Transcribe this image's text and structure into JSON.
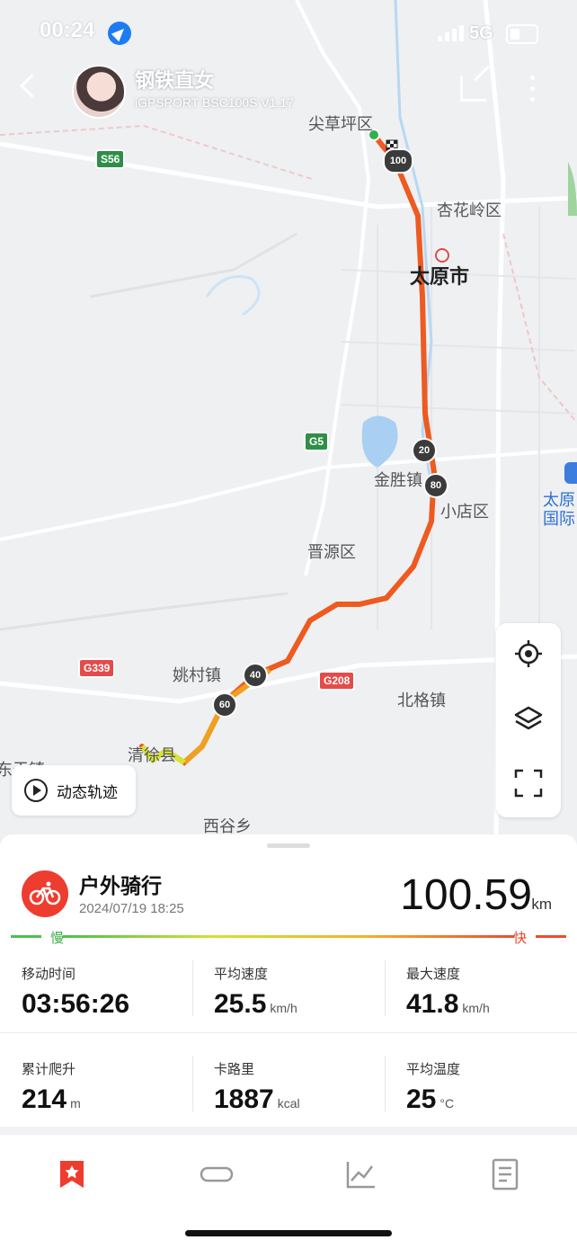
{
  "status_bar": {
    "time": "00:24",
    "network": "5G"
  },
  "header": {
    "user_name": "钢铁直女",
    "device": "iGPSPORT BSC100S V1.17"
  },
  "map": {
    "labels": {
      "jiancaoping": "尖草坪区",
      "xinghualing": "杏花岭区",
      "taiyuan": "太原市",
      "jinsheng": "金胜镇",
      "xiaodian": "小店区",
      "jinyuan": "晋源区",
      "yaocun": "姚村镇",
      "beige": "北格镇",
      "qingxu": "清徐县",
      "dongyu": "东于镇",
      "xigu": "西谷乡",
      "airport": "太原\n国际"
    },
    "shields": {
      "s56": "S56",
      "g5": "G5",
      "g339": "G339",
      "g208": "G208"
    },
    "km_markers": [
      "100",
      "20",
      "80",
      "40",
      "60"
    ]
  },
  "controls": {
    "playback_label": "动态轨迹"
  },
  "summary": {
    "sport": "户外骑行",
    "datetime": "2024/07/19 18:25",
    "distance": "100.59",
    "distance_unit": "km",
    "slow": "慢",
    "fast": "快"
  },
  "stats": [
    {
      "label": "移动时间",
      "value": "03:56:26",
      "unit": ""
    },
    {
      "label": "平均速度",
      "value": "25.5",
      "unit": "km/h"
    },
    {
      "label": "最大速度",
      "value": "41.8",
      "unit": "km/h"
    },
    {
      "label": "累计爬升",
      "value": "214",
      "unit": "m"
    },
    {
      "label": "卡路里",
      "value": "1887",
      "unit": "kcal"
    },
    {
      "label": "平均温度",
      "value": "25",
      "unit": "°C"
    }
  ],
  "tabs": [
    "bookmark-icon",
    "route-icon",
    "chart-icon",
    "report-icon"
  ],
  "colors": {
    "accent": "#ee3c2f",
    "route_fast": "#ee4d2e",
    "route_slow": "#d9e030"
  }
}
